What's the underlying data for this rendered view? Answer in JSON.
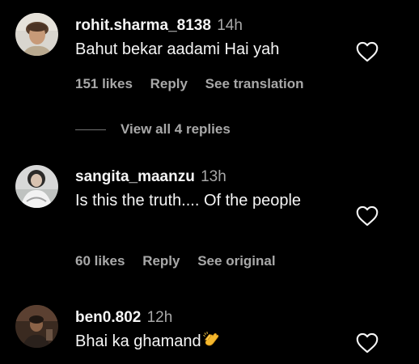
{
  "colors": {
    "background": "#000000",
    "primary_text": "#f5f5f5",
    "secondary_text": "#a8a8a8",
    "divider": "#737373"
  },
  "comments": [
    {
      "username": "rohit.sharma_8138",
      "time": "14h",
      "text": "Bahut bekar aadami Hai yah",
      "likes": "151 likes",
      "reply_label": "Reply",
      "translate_label": "See translation",
      "view_replies": "View all 4 replies"
    },
    {
      "username": "sangita_maanzu",
      "time": "13h",
      "text": "Is this the truth.... Of the people",
      "likes": "60 likes",
      "reply_label": "Reply",
      "translate_label": "See original"
    },
    {
      "username": "ben0.802",
      "time": "12h",
      "text": "Bhai ka ghamand",
      "emoji": "clapping-hands-emoji"
    }
  ],
  "icons": {
    "like": "heart-outline-icon"
  }
}
